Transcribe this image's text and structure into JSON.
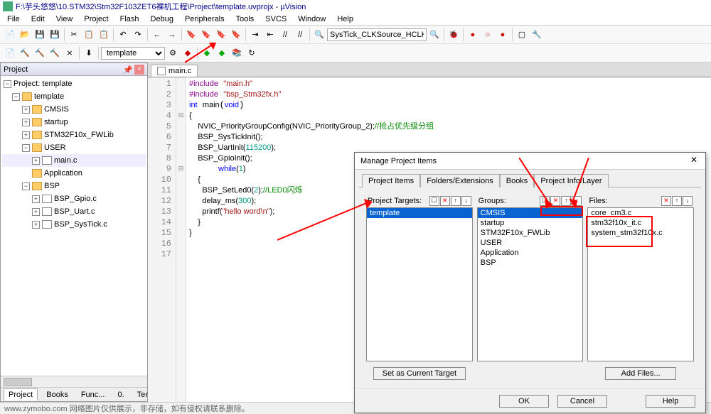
{
  "title": "F:\\芋头悠悠\\10.STM32\\Stm32F103ZET6裸机工程\\Project\\template.uvprojx - µVision",
  "menus": [
    "File",
    "Edit",
    "View",
    "Project",
    "Flash",
    "Debug",
    "Peripherals",
    "Tools",
    "SVCS",
    "Window",
    "Help"
  ],
  "toolbar_search_value": "SysTick_CLKSource_HCLK",
  "target_combo": "template",
  "project_panel": {
    "title": "Project",
    "root": "Project: template",
    "target": "template",
    "groups": [
      "CMSIS",
      "startup",
      "STM32F10x_FWLib",
      "USER",
      "Application",
      "BSP"
    ],
    "user_files": [
      "main.c"
    ],
    "bsp_files": [
      "BSP_Gpio.c",
      "BSP_Uart.c",
      "BSP_SysTick.c"
    ],
    "tabs": [
      "Project",
      "Books",
      "Func...",
      "0.",
      "Temp..."
    ]
  },
  "editor": {
    "tab": "main.c",
    "lines": 17,
    "code": {
      "l1a": "#include",
      "l1b": "\"main.h\"",
      "l2a": "#include",
      "l2b": "\"bsp_Stm32fx.h\"",
      "l3a": "int",
      "l3b": "main",
      "l3c": "void",
      "l4": "{",
      "l5a": "    NVIC_PriorityGroupConfig(NVIC_PriorityGroup_2);",
      "l5b": "//抢占优先级分组",
      "l6": "    BSP_SysTickInit();",
      "l7a": "    BSP_UartInit(",
      "l7n": "115200",
      "l7c": ");",
      "l8": "    BSP_GpioInit();",
      "l9a": "    while",
      "l9b": "(",
      "l9n": "1",
      "l9c": ")",
      "l10": "    {",
      "l11a": "      BSP_SetLed0(",
      "l11n": "2",
      "l11b": ");",
      "l11c": "//LED0闪烁",
      "l12a": "      delay_ms(",
      "l12n": "300",
      "l12b": ");",
      "l13a": "      printf(",
      "l13s": "\"hello word\\n\"",
      "l13b": ");",
      "l14": "    }",
      "l15": "}"
    }
  },
  "dialog": {
    "title": "Manage Project Items",
    "tabs": [
      "Project Items",
      "Folders/Extensions",
      "Books",
      "Project Info/Layer"
    ],
    "active_tab": 0,
    "col1": {
      "label": "Project Targets:",
      "items": [
        "template"
      ],
      "btn": "Set as Current Target"
    },
    "col2": {
      "label": "Groups:",
      "items": [
        "CMSIS",
        "startup",
        "STM32F10x_FWLib",
        "USER",
        "Application",
        "BSP"
      ]
    },
    "col3": {
      "label": "Files:",
      "items": [
        "core_cm3.c",
        "stm32f10x_it.c",
        "system_stm32f10x.c"
      ],
      "btn": "Add Files..."
    },
    "buttons": {
      "ok": "OK",
      "cancel": "Cancel",
      "help": "Help"
    }
  },
  "watermark": "www.zymobo.com 网络图片仅供展示，非存储，如有侵权请联系删除。"
}
